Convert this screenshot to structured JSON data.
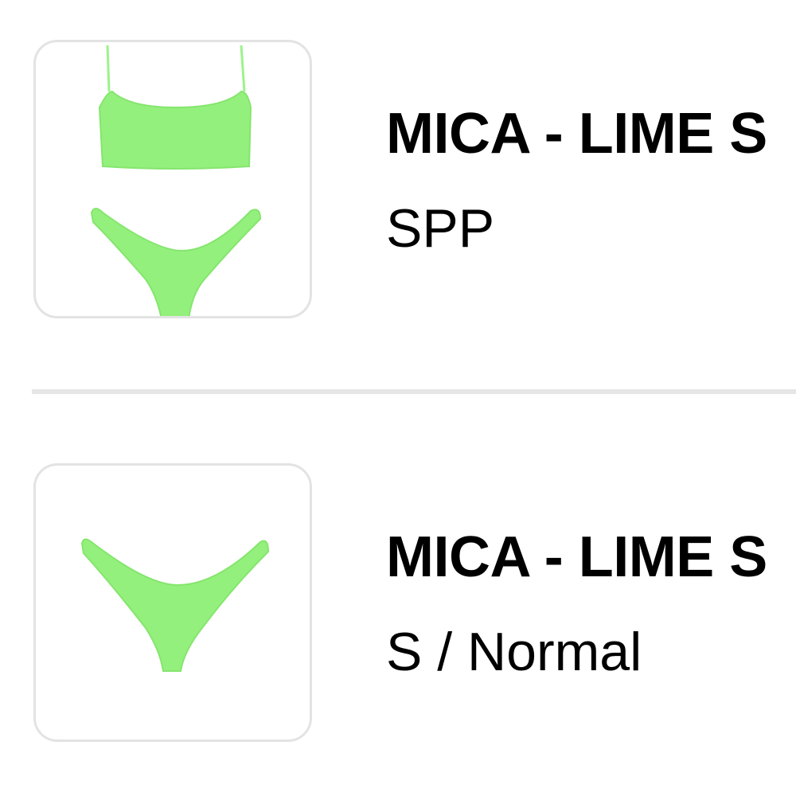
{
  "items": [
    {
      "title": "MICA - LIME S",
      "variant": "SPP",
      "image": "bikini-set-top-and-bottom",
      "image_color": "#8ef07a"
    },
    {
      "title": "MICA - LIME S",
      "variant": "S / Normal",
      "image": "bikini-bottom",
      "image_color": "#8ef07a"
    }
  ],
  "colors": {
    "divider": "#e6e6e6",
    "thumbnail_border": "#e3e3e3",
    "text": "#000000"
  }
}
